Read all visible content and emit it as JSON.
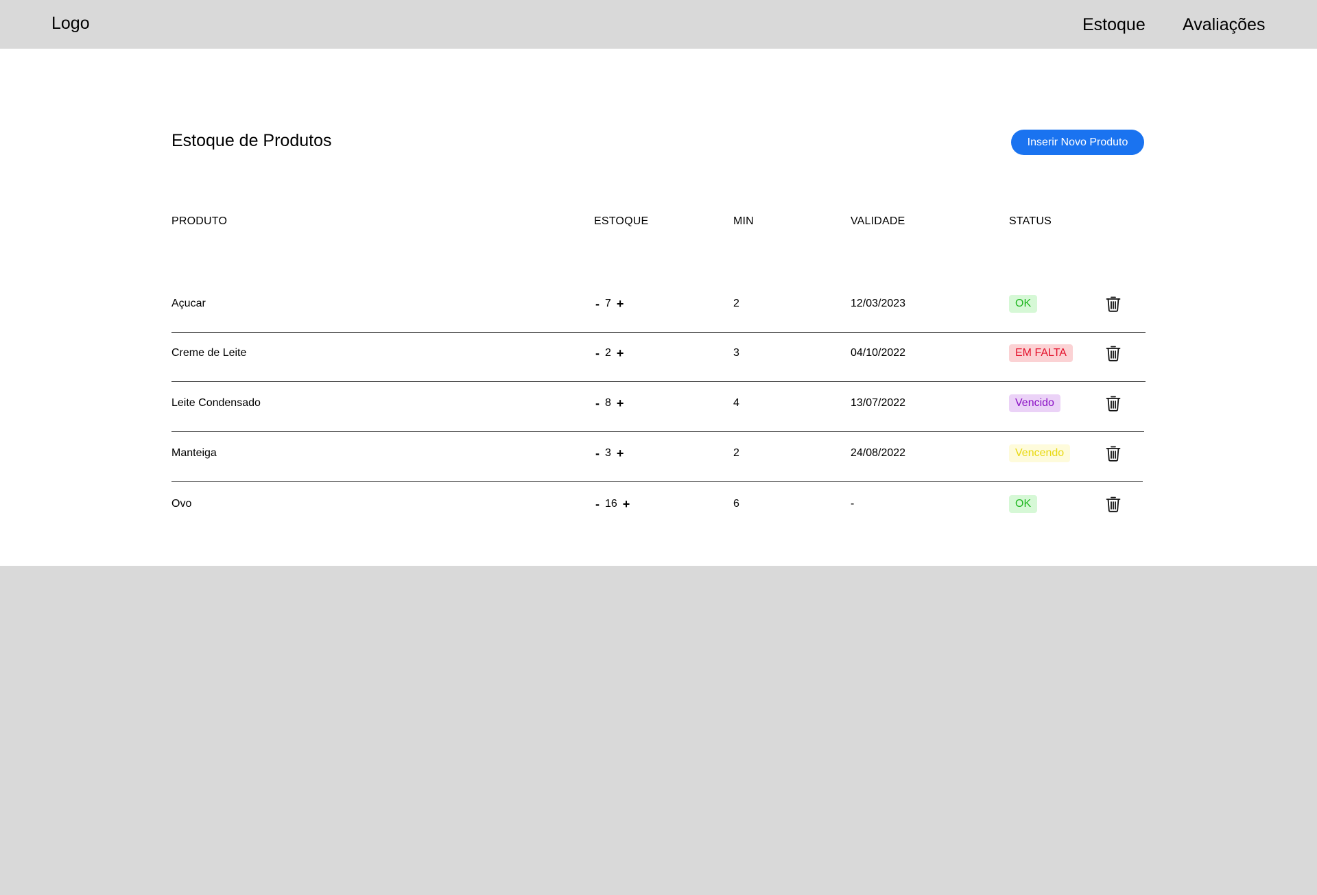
{
  "header": {
    "logo": "Logo",
    "nav": [
      {
        "label": "Estoque"
      },
      {
        "label": "Avaliações"
      }
    ]
  },
  "main": {
    "title": "Estoque de Produtos",
    "add_button_label": "Inserir Novo Produto"
  },
  "table": {
    "columns": [
      "PRODUTO",
      "ESTOQUE",
      "MIN",
      "VALIDADE",
      "STATUS"
    ],
    "rows": [
      {
        "product": "Açucar",
        "stock": "7",
        "min": "2",
        "expiry": "12/03/2023",
        "status": "OK"
      },
      {
        "product": "Creme de Leite",
        "stock": "2",
        "min": "3",
        "expiry": "04/10/2022",
        "status": "EM FALTA"
      },
      {
        "product": "Leite Condensado",
        "stock": "8",
        "min": "4",
        "expiry": "13/07/2022",
        "status": "Vencido"
      },
      {
        "product": "Manteiga",
        "stock": "3",
        "min": "2",
        "expiry": "24/08/2022",
        "status": "Vencendo"
      },
      {
        "product": "Ovo",
        "stock": "16",
        "min": "6",
        "expiry": "-",
        "status": "OK"
      }
    ],
    "stepper": {
      "minus": "-",
      "plus": "+"
    }
  },
  "status_colors": {
    "OK": {
      "bg": "#d6f8d6",
      "fg": "#1fb71f"
    },
    "EM FALTA": {
      "bg": "#fbd2d4",
      "fg": "#e4102a"
    },
    "Vencido": {
      "bg": "#ebd2f7",
      "fg": "#8a0fc4"
    },
    "Vencendo": {
      "bg": "#fefbdb",
      "fg": "#e8d80f"
    }
  },
  "icons": {
    "delete": "trash-icon"
  },
  "colors": {
    "accent": "#1a73f0",
    "chrome": "#d9d9d9",
    "surface": "#ffffff"
  }
}
